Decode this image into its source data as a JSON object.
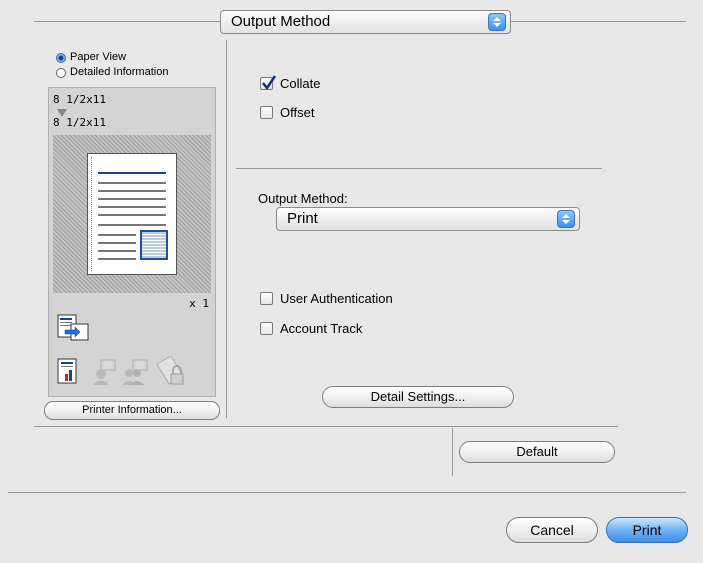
{
  "header": {
    "panel_select": "Output Method"
  },
  "preview": {
    "view_options": [
      {
        "label": "Paper View",
        "selected": true
      },
      {
        "label": "Detailed Information",
        "selected": false
      }
    ],
    "paper_original": "8 1/2x11",
    "paper_output": "8 1/2x11",
    "copies": "x 1",
    "printer_info_button": "Printer Information..."
  },
  "options": {
    "collate": {
      "label": "Collate",
      "checked": true
    },
    "offset": {
      "label": "Offset",
      "checked": false
    },
    "output_method_label": "Output Method:",
    "output_method_value": "Print",
    "user_auth": {
      "label": "User Authentication",
      "checked": false
    },
    "account_track": {
      "label": "Account Track",
      "checked": false
    },
    "detail_settings_button": "Detail Settings..."
  },
  "footer": {
    "default_button": "Default",
    "cancel_button": "Cancel",
    "print_button": "Print"
  },
  "colors": {
    "accent": "#3f8fe8",
    "page_line": "#1f3f8f"
  }
}
